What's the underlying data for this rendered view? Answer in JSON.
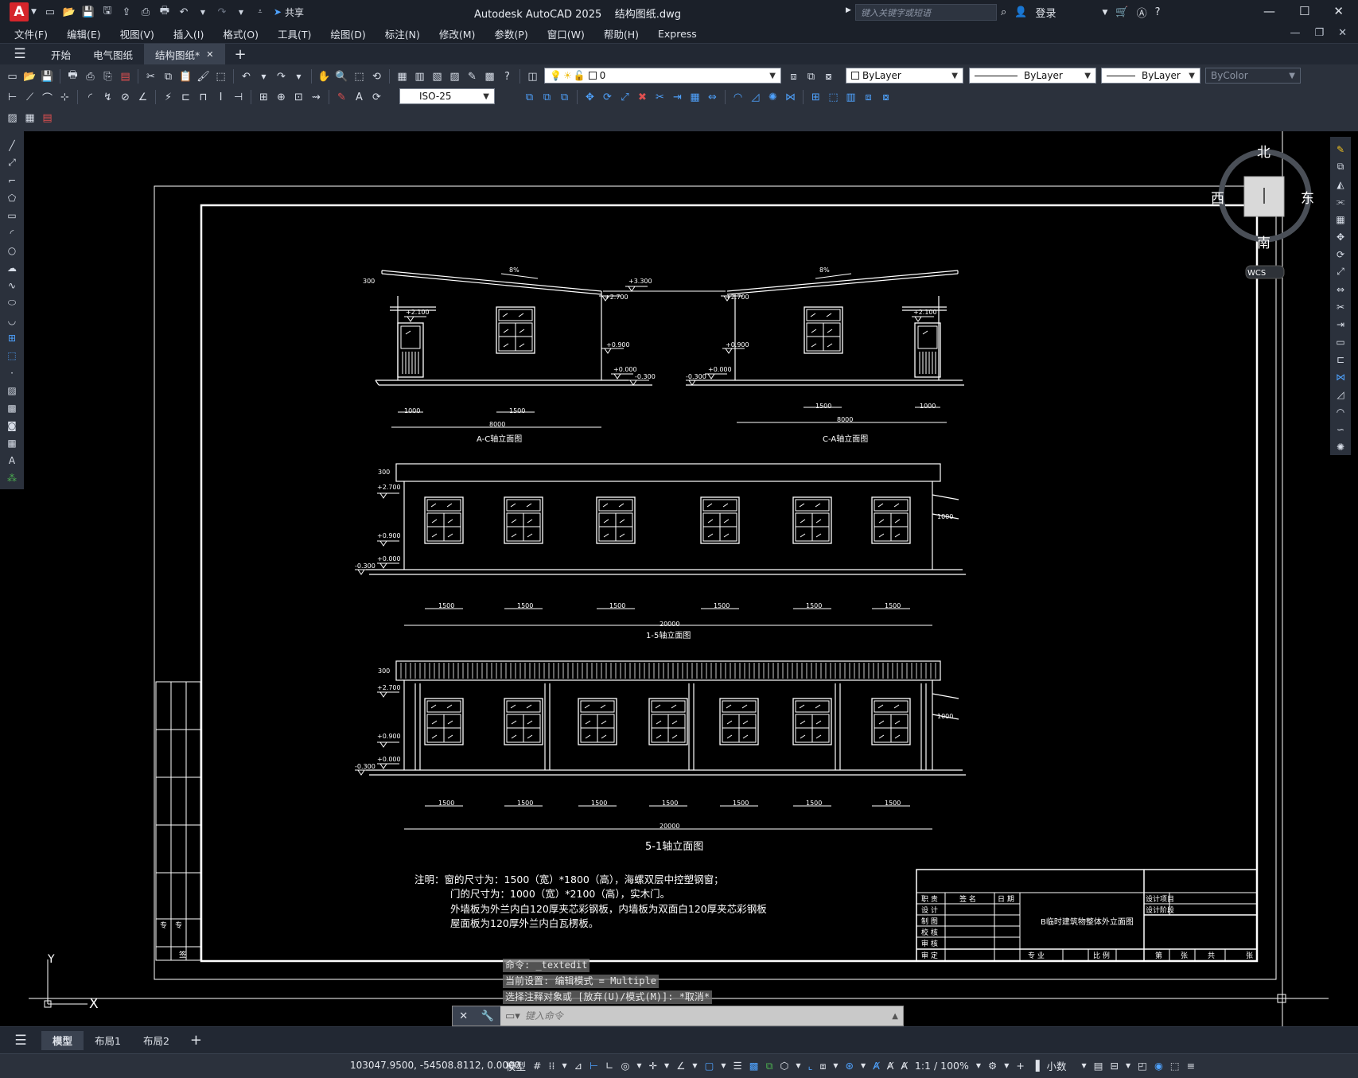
{
  "app": {
    "title": "Autodesk AutoCAD 2025",
    "file": "结构图纸.dwg",
    "logo": "A",
    "share": "共享",
    "search_placeholder": "键入关键字或短语",
    "login": "登录"
  },
  "menu": [
    "文件(F)",
    "编辑(E)",
    "视图(V)",
    "插入(I)",
    "格式(O)",
    "工具(T)",
    "绘图(D)",
    "标注(N)",
    "修改(M)",
    "参数(P)",
    "窗口(W)",
    "帮助(H)",
    "Express"
  ],
  "tabs": [
    {
      "label": "开始",
      "active": false
    },
    {
      "label": "电气图纸",
      "active": false
    },
    {
      "label": "结构图纸*",
      "active": true
    }
  ],
  "toolbar": {
    "layer_name": "0",
    "color": "ByLayer",
    "linetype": "ByLayer",
    "lineweight": "ByLayer",
    "plotstyle": "ByColor",
    "dimstyle": "ISO-25"
  },
  "viewcube": {
    "north": "北",
    "south": "南",
    "east": "东",
    "west": "西",
    "wcs": "WCS"
  },
  "drawing": {
    "view1": {
      "title": "A-C轴立面图",
      "levels": [
        "+3.300",
        "+2.700",
        "+2.100",
        "+0.900",
        "+0.000",
        "-0.300"
      ],
      "slope": "8%",
      "dims": [
        "300",
        "1000",
        "1500",
        "8000"
      ]
    },
    "view2": {
      "title": "C-A轴立面图",
      "levels": [
        "+2.700",
        "+2.100",
        "+0.900",
        "+0.000",
        "-0.300"
      ],
      "slope": "8%",
      "dims": [
        "1500",
        "1000",
        "8000"
      ]
    },
    "view3": {
      "title": "1-5轴立面图",
      "levels": [
        "+2.700",
        "+0.900",
        "+0.000",
        "-0.300"
      ],
      "dims": [
        "300",
        "1000",
        "1500",
        "20000"
      ]
    },
    "view4": {
      "title": "5-1轴立面图",
      "levels": [
        "+2.700",
        "+0.900",
        "+0.000",
        "-0.300"
      ],
      "dims": [
        "300",
        "1000",
        "1500",
        "20000"
      ]
    },
    "notes": [
      "注明：窗的尺寸为：1500（宽）*1800（高），海螺双层中控塑钢窗；",
      "门的尺寸为：1000（宽）*2100（高），实木门。",
      "外墙板为外兰内白120厚夹芯彩钢板，内墙板为双面白120厚夹芯彩钢板",
      "屋面板为120厚外兰内白瓦楞板。"
    ],
    "titleblock": {
      "drawing_name": "B临时建筑物整体外立面图",
      "roles": [
        "职 责",
        "设 计",
        "制 图",
        "校 核",
        "审 核",
        "审 定"
      ],
      "headers": [
        "签 名",
        "日 期"
      ],
      "right_labels": [
        "设计项目",
        "设计阶段"
      ],
      "bottom": [
        "专 业",
        "比 例",
        "第",
        "张",
        "共",
        "张"
      ]
    },
    "side_stamp": [
      "专",
      "专",
      "签"
    ],
    "ucs": {
      "y": "Y",
      "x": "X"
    }
  },
  "command": {
    "history": [
      "命令: _textedit",
      "当前设置: 编辑模式 = Multiple",
      "选择注释对象或 [放弃(U)/模式(M)]: *取消*"
    ],
    "placeholder": "键入命令"
  },
  "layout_tabs": [
    {
      "label": "模型",
      "active": true
    },
    {
      "label": "布局1",
      "active": false
    },
    {
      "label": "布局2",
      "active": false
    }
  ],
  "status": {
    "coords": "103047.9500, -54508.8112, 0.0000",
    "model": "模型",
    "scale": "1:1 / 100%",
    "units": "小数"
  }
}
